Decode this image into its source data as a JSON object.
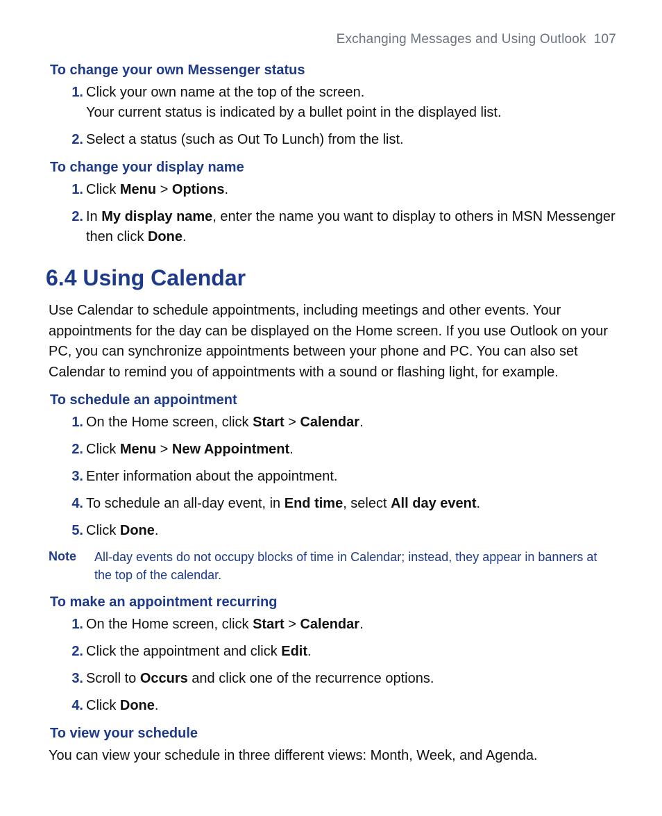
{
  "header": {
    "running": "Exchanging Messages and Using Outlook  107"
  },
  "sec1": {
    "h": "To change your own Messenger status",
    "s1_num": "1.",
    "s1_t1": "Click your own name at the top of the screen.",
    "s1_t2": "Your current status is indicated by a bullet point in the displayed list.",
    "s2_num": "2.",
    "s2_t": "Select a status (such as Out To Lunch) from the list."
  },
  "sec2": {
    "h": "To change your display name",
    "s1_num": "1.",
    "s1_a": "Click ",
    "s1_b": "Menu",
    "s1_c": " > ",
    "s1_d": "Options",
    "s1_e": ".",
    "s2_num": "2.",
    "s2_a": "In ",
    "s2_b": "My display name",
    "s2_c": ", enter the name you want to display to others in MSN Messenger then click ",
    "s2_d": "Done",
    "s2_e": "."
  },
  "main": {
    "h": "6.4 Using Calendar",
    "p": "Use Calendar to schedule appointments, including meetings and other events. Your appointments for the day can be displayed on the Home screen. If you use Outlook on your PC, you can synchronize appointments between your phone and PC. You can also set Calendar to remind you of appointments with a sound or flashing light, for example."
  },
  "sec3": {
    "h": "To schedule an appointment",
    "s1_num": "1.",
    "s1_a": "On the Home screen, click ",
    "s1_b": "Start",
    "s1_c": " > ",
    "s1_d": "Calendar",
    "s1_e": ".",
    "s2_num": "2.",
    "s2_a": "Click ",
    "s2_b": "Menu",
    "s2_c": " > ",
    "s2_d": "New Appointment",
    "s2_e": ".",
    "s3_num": "3.",
    "s3_t": "Enter information about the appointment.",
    "s4_num": "4.",
    "s4_a": "To schedule an all-day event, in ",
    "s4_b": "End time",
    "s4_c": ", select ",
    "s4_d": "All day event",
    "s4_e": ".",
    "s5_num": "5.",
    "s5_a": "Click ",
    "s5_b": "Done",
    "s5_c": "."
  },
  "note": {
    "label": "Note",
    "text": "All-day events do not occupy blocks of time in Calendar; instead, they appear in banners at the top of the calendar."
  },
  "sec4": {
    "h": "To make an appointment recurring",
    "s1_num": "1.",
    "s1_a": "On the Home screen, click ",
    "s1_b": "Start",
    "s1_c": " > ",
    "s1_d": "Calendar",
    "s1_e": ".",
    "s2_num": "2.",
    "s2_a": "Click the appointment and click ",
    "s2_b": "Edit",
    "s2_c": ".",
    "s3_num": "3.",
    "s3_a": "Scroll to ",
    "s3_b": "Occurs",
    "s3_c": " and click one of the recurrence options.",
    "s4_num": "4.",
    "s4_a": "Click ",
    "s4_b": "Done",
    "s4_c": "."
  },
  "sec5": {
    "h": "To view your schedule",
    "p": "You can view your schedule in three different views: Month, Week, and Agenda."
  }
}
